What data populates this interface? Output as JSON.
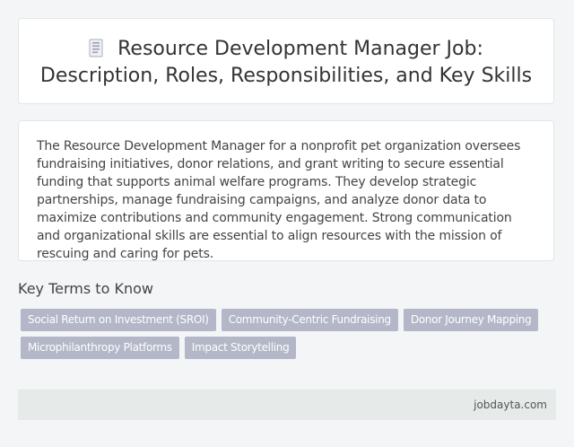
{
  "header": {
    "icon": "document-icon",
    "title_line1": "Resource Development Manager Job:",
    "title_line2": "Description, Roles, Responsibilities, and Key Skills"
  },
  "description": {
    "text": "The Resource Development Manager for a nonprofit pet organization oversees fundraising initiatives, donor relations, and grant writing to secure essential funding that supports animal welfare programs. They develop strategic partnerships, manage fundraising campaigns, and analyze donor data to maximize contributions and community engagement. Strong communication and organizational skills are essential to align resources with the mission of rescuing and caring for pets."
  },
  "key_terms": {
    "heading": "Key Terms to Know",
    "tags": [
      "Social Return on Investment (SROI)",
      "Community-Centric Fundraising",
      "Donor Journey Mapping",
      "Microphilanthropy Platforms",
      "Impact Storytelling"
    ]
  },
  "footer": {
    "site": "jobdayta.com"
  },
  "colors": {
    "tag_background": "#b3b7c8",
    "footer_background": "#e6ebea",
    "page_background": "#f3f5f6"
  }
}
